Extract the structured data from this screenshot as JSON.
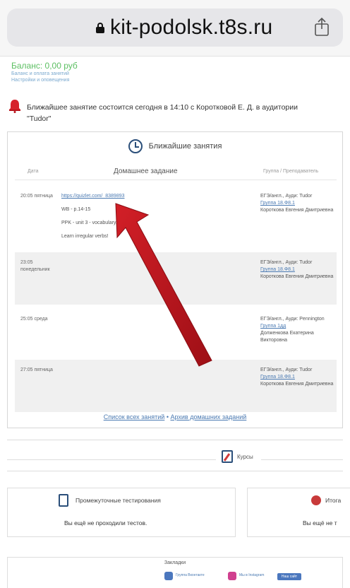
{
  "browser": {
    "url": "kit-podolsk.t8s.ru"
  },
  "account": {
    "balance": "Баланс: 0,00 руб",
    "link_1": "Баланс и оплата занятий",
    "link_2": "Настройки и оповещения"
  },
  "notice": {
    "text": "Ближайшее занятие состоится сегодня в 14:10 с Коротковой Е. Д. в аудитории\n\"Tudor\""
  },
  "upcoming": {
    "title": "Ближайшие занятия",
    "col_date": "Дата",
    "col_homework": "Домашнее задание",
    "col_group": "Группа / Преподаватель",
    "rows": [
      {
        "date": "20:05 пятница",
        "homework": [
          "https://quizlet.com/_8389893",
          "WB - p.14-15",
          "PPK - unit 3 - vocabulary... ex. 1",
          "Learn irregular verbs!"
        ],
        "group": "ЕГЭ/англ., Ауди: Tudor",
        "group_link": "Группа 18.Ф8.1",
        "teacher": "Короткова Евгения Дмитриевна"
      },
      {
        "date": "23:05 понедельник",
        "homework": [],
        "group": "ЕГЭ/англ., Ауди: Tudor",
        "group_link": "Группа 18.Ф8.1",
        "teacher": "Короткова Евгения Дмитриевна"
      },
      {
        "date": "25:05 среда",
        "homework": [],
        "group": "ЕГЭ/англ., Ауди: Pennington",
        "group_link": "Группа 1дд",
        "teacher": "Долженкова Екатерина Викторовна"
      },
      {
        "date": "27:05 пятница",
        "homework": [],
        "group": "ЕГЭ/англ., Ауди: Tudor",
        "group_link": "Группа 18.Ф8.1",
        "teacher": "Короткова Евгения Дмитриевна"
      }
    ],
    "link_all": "Список всех занятий",
    "separator": "•",
    "link_archive": "Архив домашних заданий"
  },
  "courses": {
    "title": "Курсы"
  },
  "tests": {
    "title": "Промежуточные тестирования",
    "body": "Вы ещё не проходили тестов."
  },
  "finals": {
    "title": "Итога",
    "body": "Вы ещё не т"
  },
  "bookmarks": {
    "title": "Закладки",
    "item_1": "Группа Вконтакте",
    "item_2": "Мы в Instagram",
    "button": "Наш сайт"
  },
  "colors": {
    "accent_red": "#b8141c",
    "link_blue": "#4b7ab2",
    "balance_green": "#5cbf62"
  }
}
